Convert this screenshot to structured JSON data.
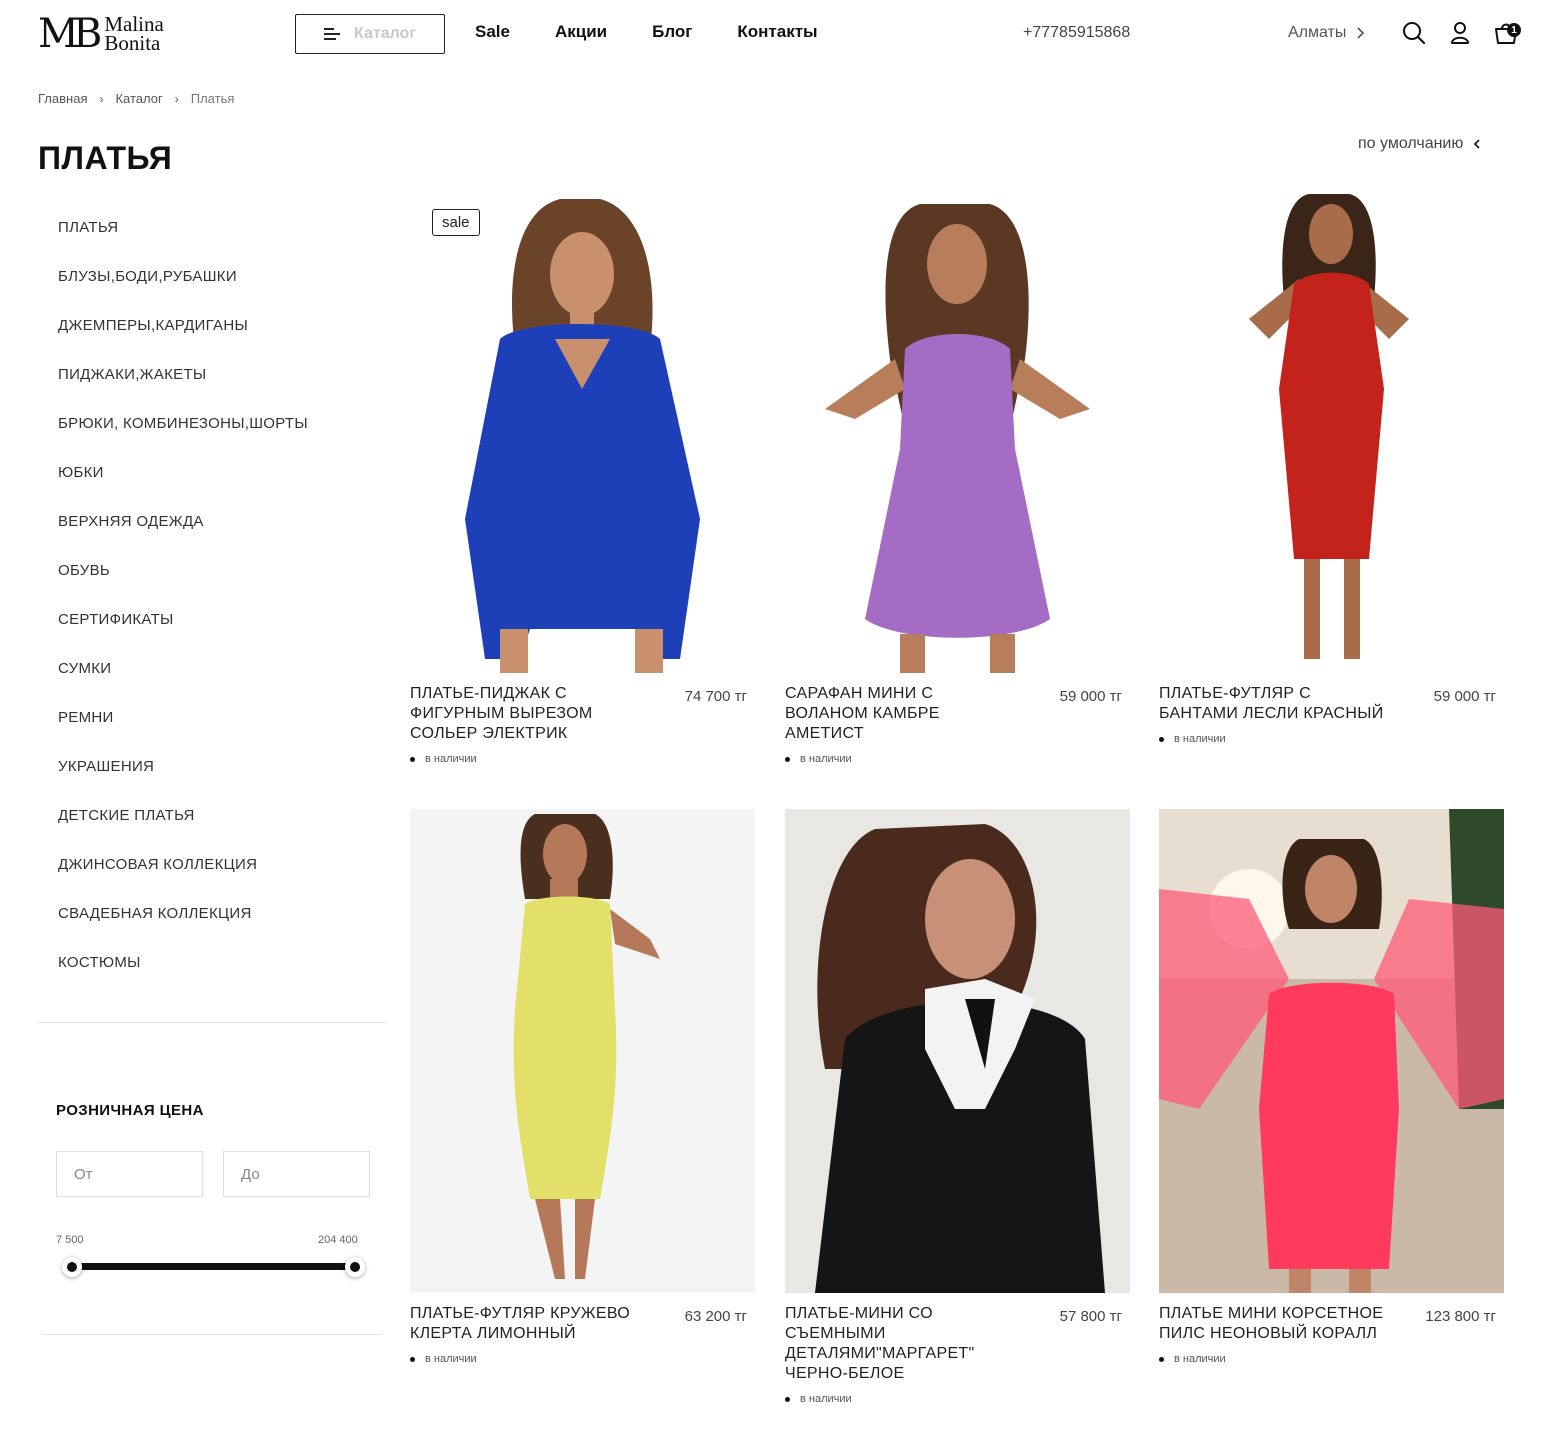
{
  "header": {
    "logo_mark": "MB",
    "logo_line1": "Malina",
    "logo_line2": "Bonita",
    "catalog_label": "Каталог",
    "nav": [
      "Sale",
      "Акции",
      "Блог",
      "Контакты"
    ],
    "phone": "+77785915868",
    "city": "Алматы",
    "cart_count": "1",
    "icons": [
      "menu-icon",
      "chevron-right-icon",
      "search-icon",
      "user-icon",
      "cart-icon"
    ]
  },
  "breadcrumb": [
    "Главная",
    "Каталог",
    "Платья"
  ],
  "page_title": "ПЛАТЬЯ",
  "sort_label": "по умолчанию",
  "categories": [
    "ПЛАТЬЯ",
    "БЛУЗЫ,БОДИ,РУБАШКИ",
    "ДЖЕМПЕРЫ,КАРДИГАНЫ",
    "ПИДЖАКИ,ЖАКЕТЫ",
    "БРЮКИ, КОМБИНЕЗОНЫ,ШОРТЫ",
    "ЮБКИ",
    "ВЕРХНЯЯ ОДЕЖДА",
    "ОБУВЬ",
    "СЕРТИФИКАТЫ",
    "СУМКИ",
    "РЕМНИ",
    "УКРАШЕНИЯ",
    "ДЕТСКИЕ ПЛАТЬЯ",
    "ДЖИНСОВАЯ КОЛЛЕКЦИЯ",
    "СВАДЕБНАЯ КОЛЛЕКЦИЯ",
    "КОСТЮМЫ"
  ],
  "price_filter": {
    "title": "РОЗНИЧНАЯ ЦЕНА",
    "from_placeholder": "От",
    "to_placeholder": "До",
    "min_label": "7 500",
    "max_label": "204 400"
  },
  "products": [
    {
      "name": "ПЛАТЬЕ-ПИДЖАК С ФИГУРНЫМ ВЫРЕЗОМ СОЛЬЕР ЭЛЕКТРИК",
      "price": "74 700 тг",
      "stock": "в наличии",
      "badge": "sale",
      "dress_color": "#1d3fb8",
      "bg": "#ffffff"
    },
    {
      "name": "САРАФАН МИНИ С ВОЛАНОМ КАМБРЕ АМЕТИСТ",
      "price": "59 000 тг",
      "stock": "в наличии",
      "dress_color": "#a56cc6",
      "bg": "#ffffff"
    },
    {
      "name": "ПЛАТЬЕ-ФУТЛЯР С БАНТАМИ ЛЕСЛИ КРАСНЫЙ",
      "price": "59 000 тг",
      "stock": "в наличии",
      "dress_color": "#c4231c",
      "bg": "#ffffff"
    },
    {
      "name": "ПЛАТЬЕ-ФУТЛЯР КРУЖЕВО КЛЕРТА ЛИМОННЫЙ",
      "price": "63 200 тг",
      "stock": "в наличии",
      "dress_color": "#e3e06a",
      "bg": "#f4f4f4"
    },
    {
      "name": "ПЛАТЬЕ-МИНИ СО СЪЕМНЫМИ ДЕТАЛЯМИ\"МАРГАРЕТ\" ЧЕРНО-БЕЛОЕ",
      "price": "57 800 тг",
      "stock": "в наличии",
      "dress_color": "#151515",
      "bg": "#e9e7e4"
    },
    {
      "name": "ПЛАТЬЕ МИНИ КОРСЕТНОЕ ПИЛС НЕОНОВЫЙ КОРАЛЛ",
      "price": "123 800 тг",
      "stock": "в наличии",
      "dress_color": "#ff3a5c",
      "bg": "#c9b9a6"
    }
  ]
}
